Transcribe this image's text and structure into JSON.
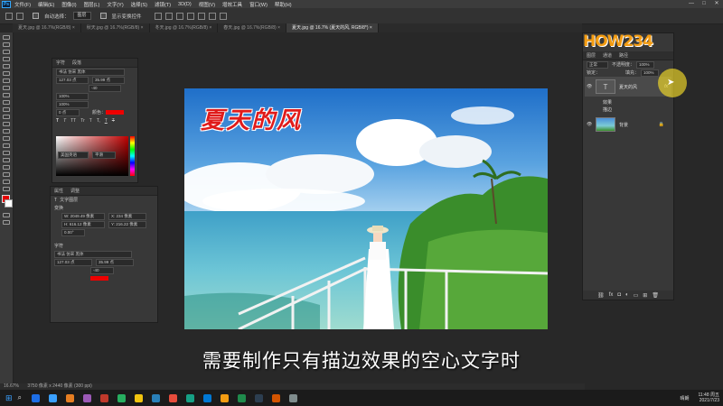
{
  "menubar": {
    "app_icon": "Ps",
    "items": [
      "文件(F)",
      "编辑(E)",
      "图像(I)",
      "图层(L)",
      "文字(Y)",
      "选择(S)",
      "滤镜(T)",
      "3D(D)",
      "视图(V)",
      "增效工具",
      "窗口(W)",
      "帮助(H)"
    ],
    "window_controls": [
      "—",
      "□",
      "✕"
    ]
  },
  "options_bar": {
    "auto_select_label": "自动选择：",
    "auto_select_value": "图层",
    "show_transform_label": "显示变换控件"
  },
  "tabs": [
    {
      "label": "夏天.jpg @ 16.7%(RGB/8) ×",
      "active": false
    },
    {
      "label": "秋天.jpg @ 16.7%(RGB/8) ×",
      "active": false
    },
    {
      "label": "冬天.jpg @ 16.7%(RGB/8) ×",
      "active": false
    },
    {
      "label": "春天.jpg @ 16.7%(RGB/8) ×",
      "active": false
    },
    {
      "label": "夏天.jpg @ 16.7% (夏天的风, RGB/8*) ×",
      "active": true
    }
  ],
  "canvas": {
    "title_text": "夏天的风",
    "subtitle": "需要制作只有描边效果的空心文字时"
  },
  "char_panel": {
    "tabs": [
      "字符",
      "段落"
    ],
    "font_family": "书法 仿宋 黑体",
    "font_size": "127.03 点",
    "leading": "35.99 点",
    "tracking": "-40",
    "scale_v": "100%",
    "scale_h": "100%",
    "baseline": "0 点",
    "color_label": "颜色：",
    "color": "#e00000",
    "style_buttons": [
      "T",
      "T",
      "TT",
      "Tr",
      "T",
      "T,",
      "T",
      "T"
    ],
    "language": "美国英语",
    "antialias": "平滑"
  },
  "props_panel": {
    "tabs": [
      "属性",
      "调整"
    ],
    "layer_type": "文字图层",
    "transform_label": "变换",
    "w_value": "W: 2049.49 像素",
    "x_value": "X: 234 像素",
    "h_value": "H: 616.12 像素",
    "y_value": "Y: 216.22 像素",
    "angle": "0.00°",
    "char_section": "字符",
    "font_family": "书法 仿宋 黑体",
    "font_size": "127.03 点",
    "leading": "35.99 点",
    "tracking": "-40"
  },
  "layers_panel": {
    "tabs": [
      "图层",
      "通道",
      "路径"
    ],
    "kind_label": "正常",
    "opacity_label": "不透明度：",
    "opacity": "100%",
    "lock_label": "锁定：",
    "fill_label": "填充：",
    "fill": "100%",
    "layers": [
      {
        "name": "夏天的风",
        "kind": "text",
        "fx": "fx",
        "effects": [
          "效果",
          "描边"
        ]
      },
      {
        "name": "背景",
        "kind": "image"
      }
    ]
  },
  "watermark": "HOW234",
  "statusbar": {
    "zoom": "16.67%",
    "doc": "3750 像素 x 2440 像素 (300 ppi)"
  },
  "taskbar": {
    "apps": [
      "#1d6ee6",
      "#3aa0ff",
      "#e67e22",
      "#9b59b6",
      "#c0392b",
      "#27ae60",
      "#f1c40f",
      "#2980b9",
      "#e74c3c",
      "#16a085",
      "#0078d4",
      "#f39c12",
      "#1f8b4c",
      "#2c3e50",
      "#d35400",
      "#7f8c8d"
    ],
    "weather": "晴朗",
    "time": "11:48 周五",
    "date": "2021/7/23"
  }
}
